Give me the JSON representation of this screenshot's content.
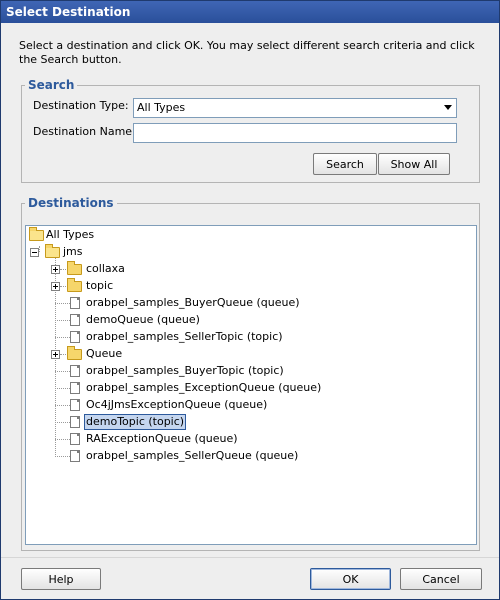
{
  "window": {
    "title": "Select Destination",
    "instructions": "Select a destination and click OK. You may select different search criteria and click the Search button."
  },
  "search": {
    "legend": "Search",
    "type_label": "Destination Type:",
    "type_value": "All Types",
    "name_label": "Destination Name:",
    "name_value": "",
    "search_button": "Search",
    "show_all_button": "Show All"
  },
  "destinations": {
    "legend": "Destinations",
    "tree": {
      "root": "All Types",
      "jms": "jms",
      "items": [
        "collaxa",
        "topic",
        "orabpel_samples_BuyerQueue (queue)",
        "demoQueue (queue)",
        "orabpel_samples_SellerTopic (topic)",
        "Queue",
        "orabpel_samples_BuyerTopic (topic)",
        "orabpel_samples_ExceptionQueue (queue)",
        "Oc4jJmsExceptionQueue (queue)",
        "demoTopic (topic)",
        "RAExceptionQueue (queue)",
        "orabpel_samples_SellerQueue (queue)"
      ],
      "selected": "demoTopic (topic)"
    }
  },
  "footer": {
    "help_button": "Help",
    "ok_button": "OK",
    "cancel_button": "Cancel"
  },
  "colors": {
    "title_bar": "#2a4f9a",
    "group_legend": "#2d5a9c",
    "selection": "#c5d6ef"
  }
}
